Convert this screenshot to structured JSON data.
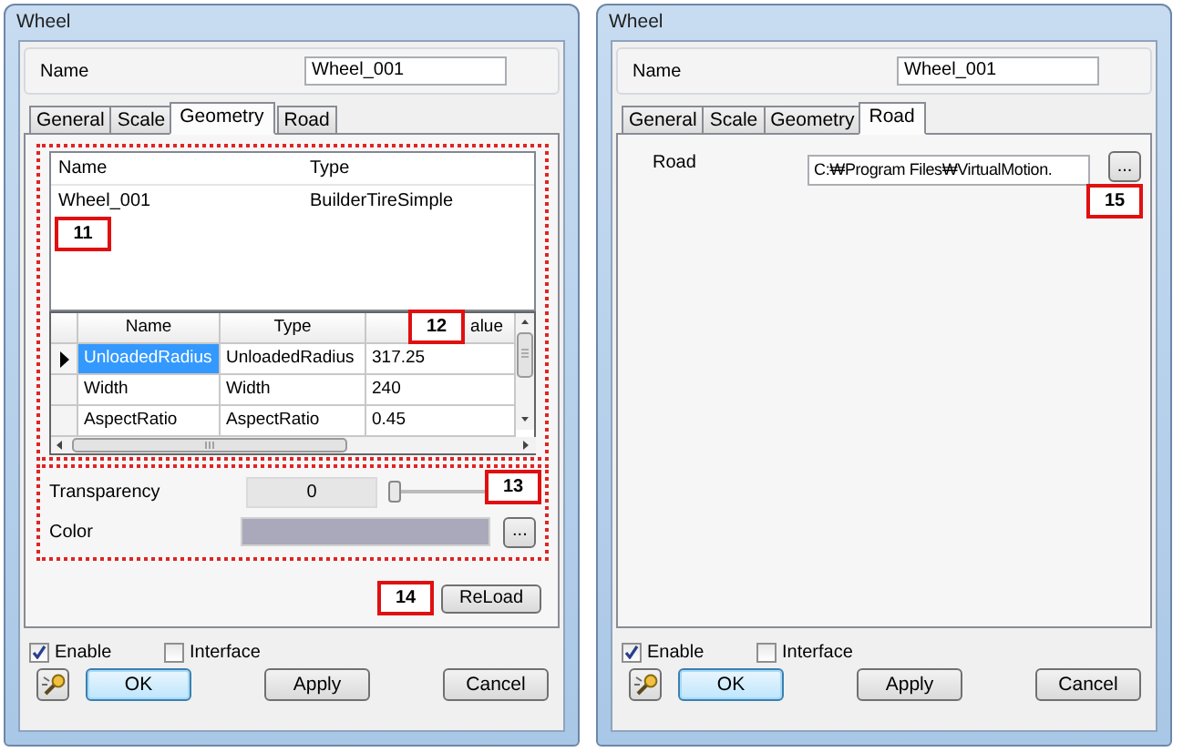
{
  "windows": [
    {
      "title": "Wheel",
      "name": {
        "label": "Name",
        "value": "Wheel_001"
      },
      "tabs": [
        {
          "label": "General",
          "selected": false
        },
        {
          "label": "Scale",
          "selected": false
        },
        {
          "label": "Geometry",
          "selected": true
        },
        {
          "label": "Road",
          "selected": false
        }
      ],
      "panel": {
        "kind": "geometry",
        "list": {
          "columns": [
            "Name",
            "Type"
          ],
          "rows": [
            [
              "Wheel_001",
              "BuilderTireSimple"
            ]
          ],
          "callout": "11"
        },
        "grid": {
          "columns": [
            "Name",
            "Type",
            "alue"
          ],
          "callout": "12",
          "rows": [
            {
              "cells": [
                "UnloadedRadius",
                "UnloadedRadius",
                "317.25"
              ],
              "selected": true
            },
            {
              "cells": [
                "Width",
                "Width",
                "240"
              ],
              "selected": false
            },
            {
              "cells": [
                "AspectRatio",
                "AspectRatio",
                "0.45"
              ],
              "selected": false
            }
          ]
        },
        "transparency": {
          "label": "Transparency",
          "value": "0",
          "level": 0
        },
        "color": {
          "label": "Color",
          "color": "#a9a9bb",
          "button": "..."
        },
        "appearance_callout": "13",
        "reload": {
          "label": "ReLoad",
          "callout": "14"
        }
      },
      "enable": {
        "label": "Enable",
        "checked": true
      },
      "interface": {
        "label": "Interface",
        "checked": false
      },
      "buttons": [
        {
          "kind": "icon"
        },
        {
          "kind": "text",
          "label": "OK",
          "focused": true
        },
        {
          "kind": "text",
          "label": "Apply",
          "focused": false
        },
        {
          "kind": "text",
          "label": "Cancel",
          "focused": false
        }
      ]
    },
    {
      "title": "Wheel",
      "name": {
        "label": "Name",
        "value": "Wheel_001"
      },
      "tabs": [
        {
          "label": "General",
          "selected": false
        },
        {
          "label": "Scale",
          "selected": false
        },
        {
          "label": "Geometry",
          "selected": false
        },
        {
          "label": "Road",
          "selected": true
        }
      ],
      "panel": {
        "kind": "road",
        "label": "Road",
        "value": "C:₩Program Files₩VirtualMotion.",
        "button": "...",
        "callout": "15"
      },
      "enable": {
        "label": "Enable",
        "checked": true
      },
      "interface": {
        "label": "Interface",
        "checked": false
      },
      "buttons": [
        {
          "kind": "icon"
        },
        {
          "kind": "text",
          "label": "OK",
          "focused": true
        },
        {
          "kind": "text",
          "label": "Apply",
          "focused": false
        },
        {
          "kind": "text",
          "label": "Cancel",
          "focused": false
        }
      ]
    }
  ]
}
